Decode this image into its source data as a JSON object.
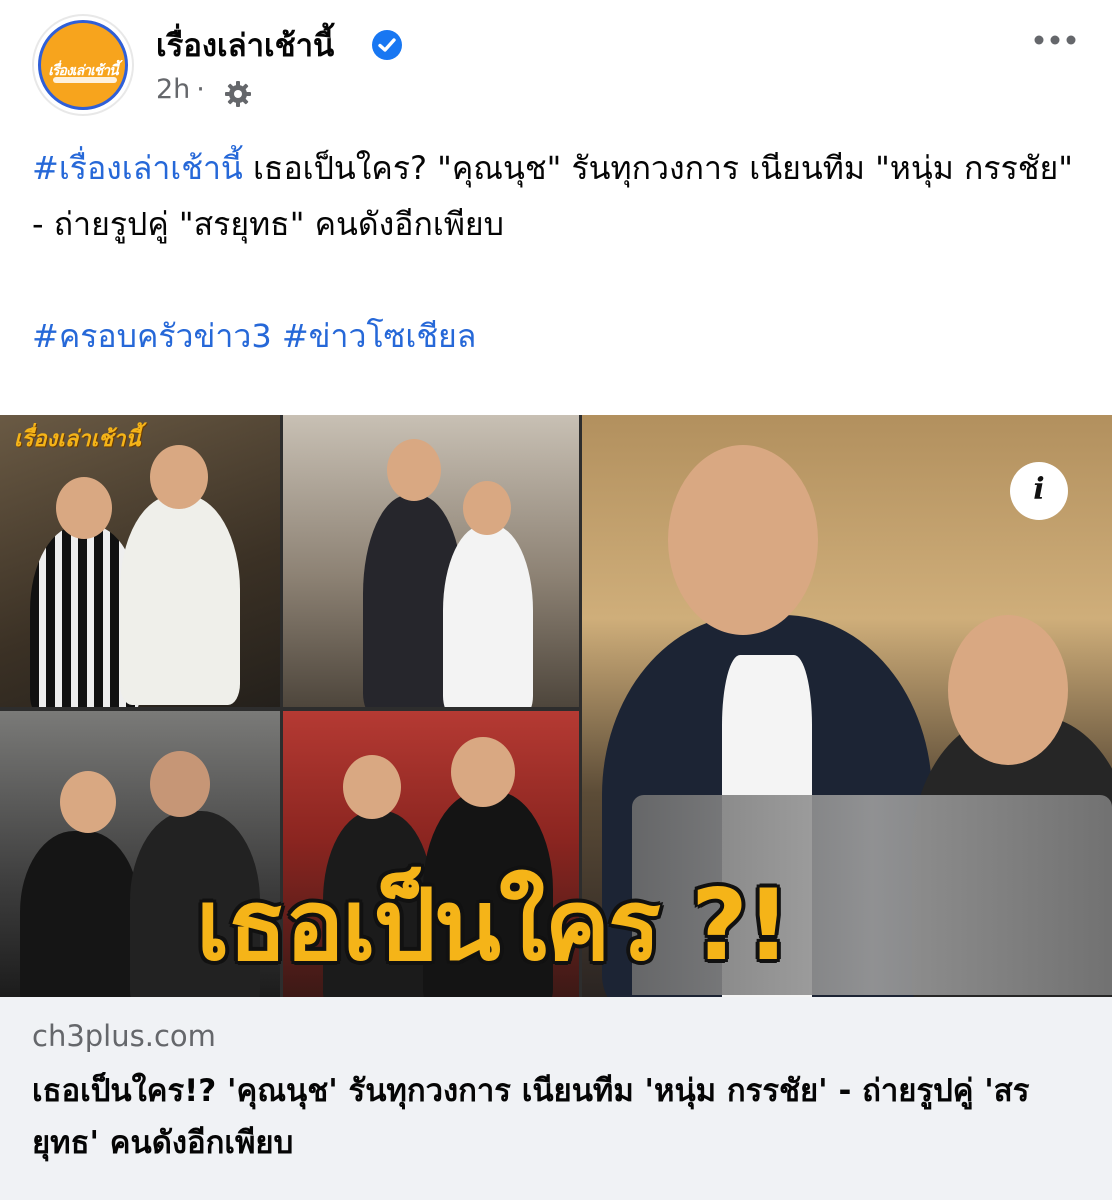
{
  "post": {
    "page_name": "เรื่องเล่าเช้านี้",
    "avatar_text": "เรื่องเล่าเช้านี้",
    "time": "2h",
    "separator": "·",
    "text_hashtag": "#เรื่องเล่าเช้านี้",
    "text_body": " เธอเป็นใคร? \"คุณนุช\" รันทุกวงการ เนียนทีม \"หนุ่ม กรรชัย\" - ถ่ายรูปคู่ \"สรยุทธ\" คนดังอีกเพียบ",
    "hashtag_1": "#ครอบครัวข่าว3",
    "hashtag_2": "#ข่าวโซเชียล"
  },
  "image": {
    "overlay_text": "เธอเป็นใคร ?!",
    "logo_text": "เรื่องเล่าเช้านี้",
    "info_label": "i"
  },
  "link": {
    "domain": "ch3plus.com",
    "title": "เธอเป็นใคร!? 'คุณนุช' รันทุกวงการ เนียนทีม 'หนุ่ม กรรชัย' - ถ่ายรูปคู่ 'สรยุทธ' คนดังอีกเพียบ"
  },
  "colors": {
    "hashtag": "#2668d8",
    "verified": "#1877f2",
    "avatar_bg": "#f7a41d",
    "avatar_ring": "#2f5fd8",
    "overlay_text": "#f5b418"
  }
}
